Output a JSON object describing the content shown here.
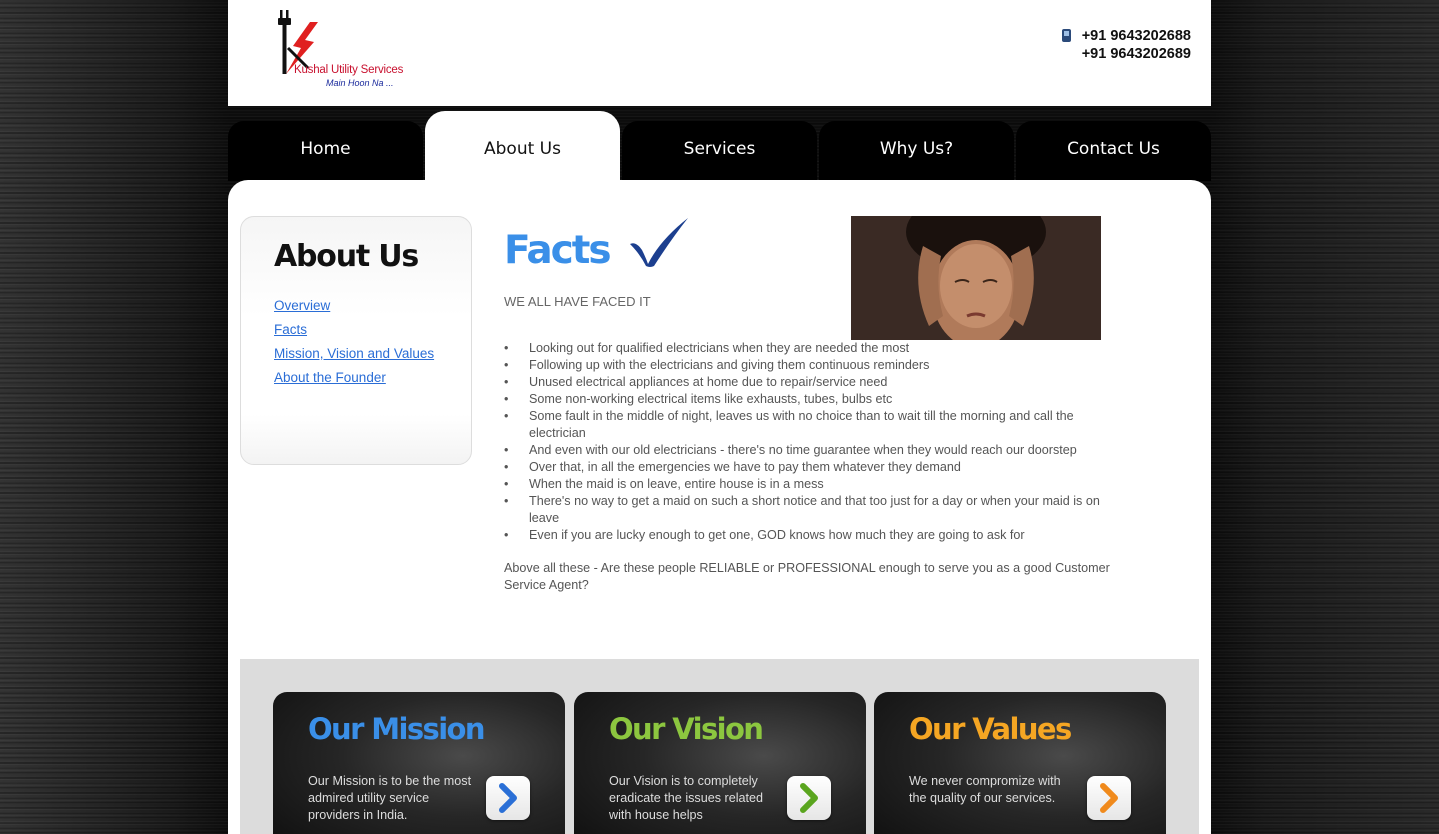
{
  "header": {
    "brand_name": "Kushal Utility Services",
    "tagline": "Main Hoon Na ...",
    "phones": [
      "+91 9643202688",
      "+91 9643202689"
    ]
  },
  "nav": {
    "items": [
      {
        "label": "Home",
        "active": false
      },
      {
        "label": "About Us",
        "active": true
      },
      {
        "label": "Services",
        "active": false
      },
      {
        "label": "Why Us?",
        "active": false
      },
      {
        "label": "Contact Us",
        "active": false
      }
    ]
  },
  "sidebar": {
    "title": "About Us",
    "links": [
      "Overview",
      "Facts",
      "Mission, Vision and Values",
      "About the Founder"
    ]
  },
  "main": {
    "heading": "Facts",
    "intro": "WE ALL HAVE FACED IT",
    "facts": [
      "Looking out for qualified electricians when they are needed the most",
      "Following up with the electricians and giving them continuous reminders",
      "Unused electrical appliances at home due to repair/service need",
      "Some non-working electrical items like exhausts, tubes, bulbs etc",
      "Some fault in the middle of night, leaves us with no choice than to wait till the morning and call the electrician",
      "And even with our old electricians - there's no time guarantee when they would reach our doorstep",
      "Over that, in all the emergencies we have to pay them whatever they demand",
      "When the maid is on leave, entire house is in a mess",
      "There's no way to get a maid on such a short notice and that too just for a day or when your maid is on leave",
      "Even if you are lucky enough to get one, GOD knows how much they are going to ask for"
    ],
    "closing": "Above all these - Are these people RELIABLE or PROFESSIONAL enough to serve you as a good Customer Service Agent?"
  },
  "cards": [
    {
      "title": "Our Mission",
      "text": "Our Mission is to be the most admired utility service providers in India.",
      "color": "#3a8fe8",
      "arrow_color": "#2a6fd6"
    },
    {
      "title": "Our Vision",
      "text": "Our Vision is to completely eradicate the issues related with house helps",
      "color": "#8cc63f",
      "arrow_color": "#5aa51e"
    },
    {
      "title": "Our Values",
      "text": "We never compromize with the quality of our services.",
      "color": "#f5a623",
      "arrow_color": "#f08a1c"
    }
  ],
  "colors": {
    "accent_blue": "#3a8fe8",
    "link_blue": "#2a6dd6",
    "brand_red": "#c8102e"
  }
}
